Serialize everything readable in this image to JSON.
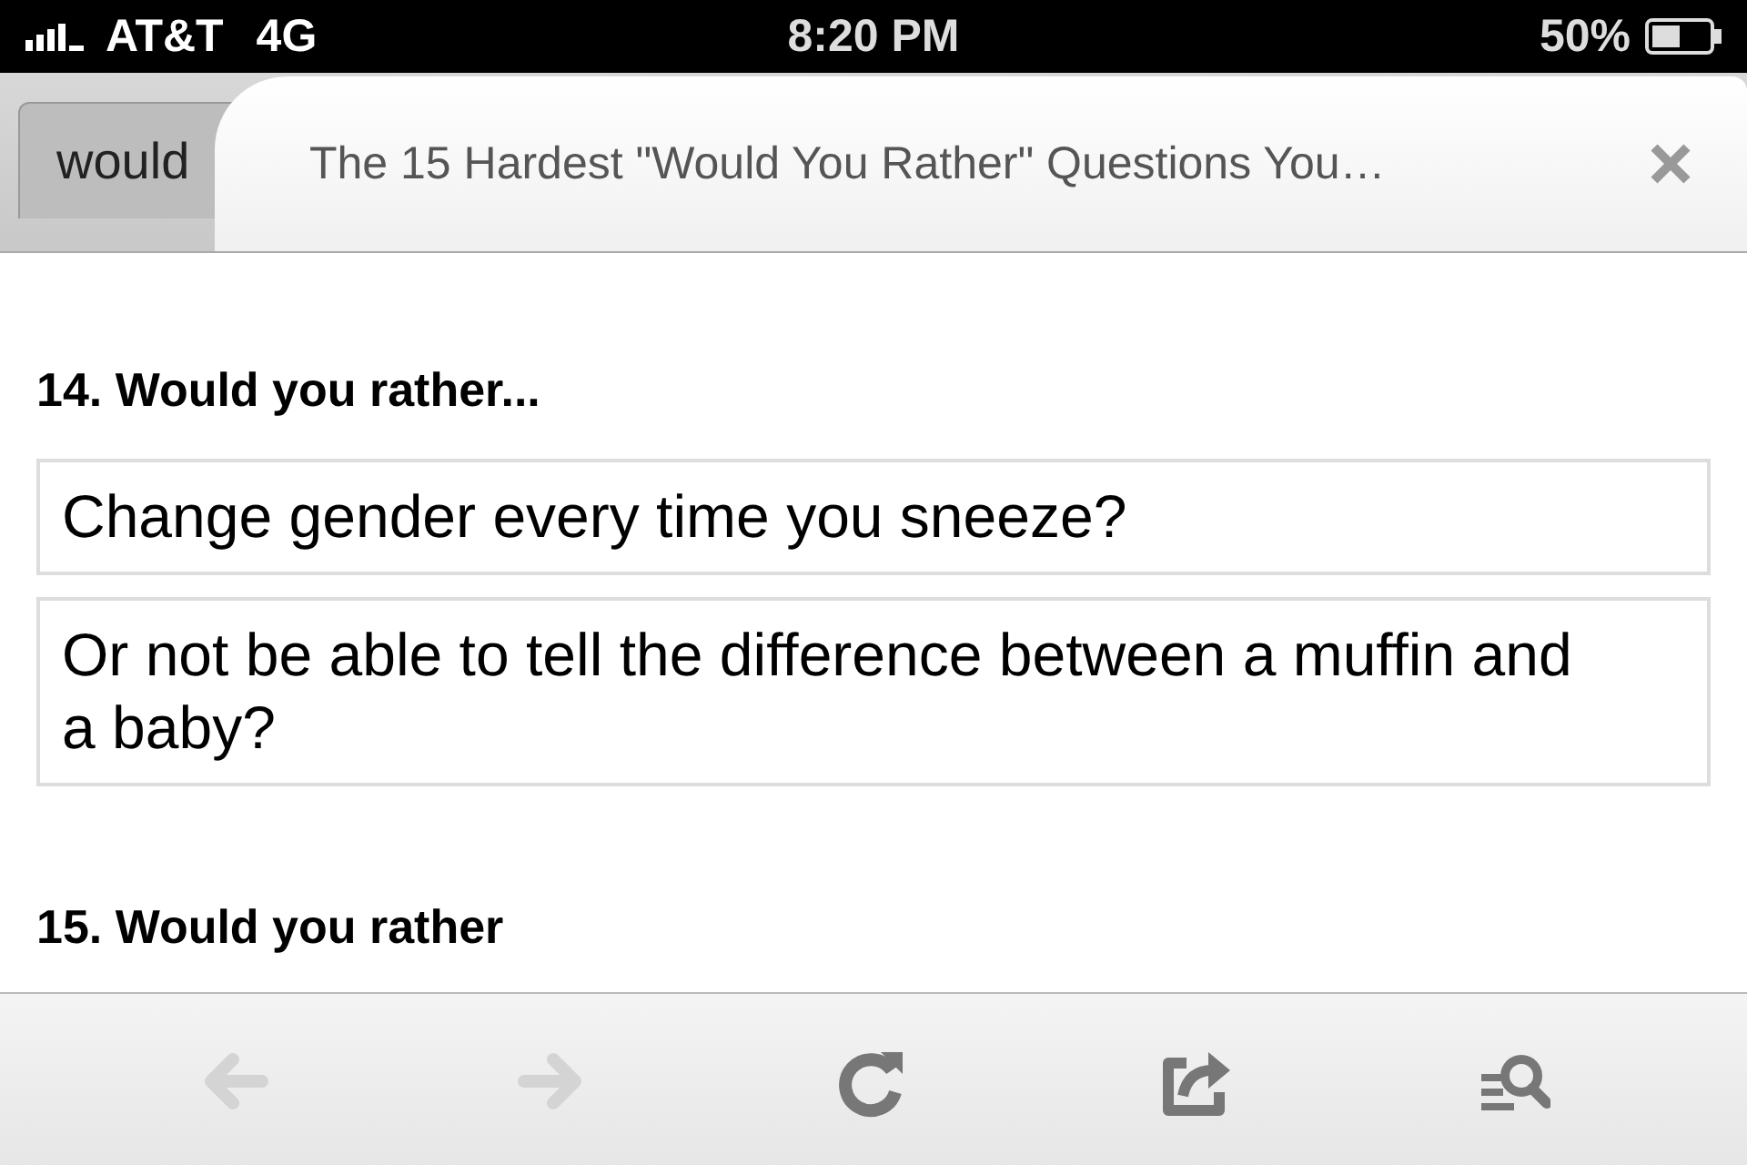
{
  "status_bar": {
    "carrier": "AT&T",
    "network": "4G",
    "time": "8:20 PM",
    "battery": "50%"
  },
  "tabs": [
    {
      "label": "would",
      "selected": false
    },
    {
      "label": "The 15 Hardest \"Would You Rather\" Questions You…",
      "selected": true
    }
  ],
  "content": {
    "heading": "14. Would you rather...",
    "options": [
      "Change gender every time you sneeze?",
      "Or not be able to tell the difference between a muffin and a baby?"
    ],
    "next_heading": "15. Would you rather"
  },
  "toolbar": [
    {
      "kind": "back",
      "disabled": true
    },
    {
      "kind": "forward",
      "disabled": true
    },
    {
      "kind": "reload",
      "disabled": false
    },
    {
      "kind": "share",
      "disabled": false
    },
    {
      "kind": "reader",
      "disabled": false
    }
  ]
}
